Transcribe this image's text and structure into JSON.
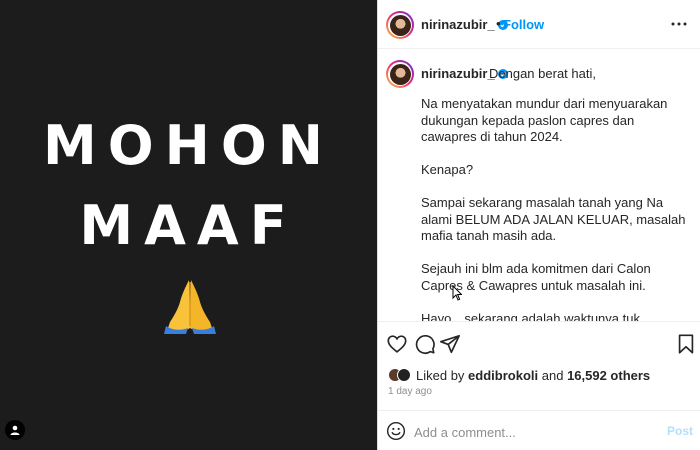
{
  "media": {
    "line1": "MOHON",
    "line2": "MAAF",
    "emoji": "folded-hands-emoji",
    "background": "#1c1c1c"
  },
  "header": {
    "username": "nirinazubir_",
    "separator": "•",
    "follow_label": "Follow",
    "follow_color": "#0095f6"
  },
  "caption": {
    "username": "nirinazubir_",
    "first_line": "Dengan berat hati,",
    "paragraphs": [
      "Na menyatakan mundur dari menyuarakan dukungan kepada paslon capres dan cawapres di tahun 2024.",
      "Kenapa?",
      "Sampai sekarang masalah tanah yang Na alami BELUM ADA JALAN KELUAR, masalah mafia tanah masih ada.",
      "Sejauh ini blm ada komitmen dari Calon Capres & Cawapres untuk masalah ini.",
      "Hayo…sekarang adalah waktunya tuk membuktikan kalau ada yang bisa menyelesaikan masalah ini."
    ]
  },
  "likes": {
    "prefix": "Liked by",
    "user": "eddibrokoli",
    "and": "and",
    "others": "16,592 others"
  },
  "timestamp": "1 day ago",
  "comment_box": {
    "placeholder": "Add a comment...",
    "post_label": "Post"
  },
  "icons": [
    "heart-icon",
    "comment-icon",
    "share-icon",
    "bookmark-icon",
    "more-icon",
    "emoji-icon",
    "verified-icon",
    "user-tag-icon"
  ]
}
